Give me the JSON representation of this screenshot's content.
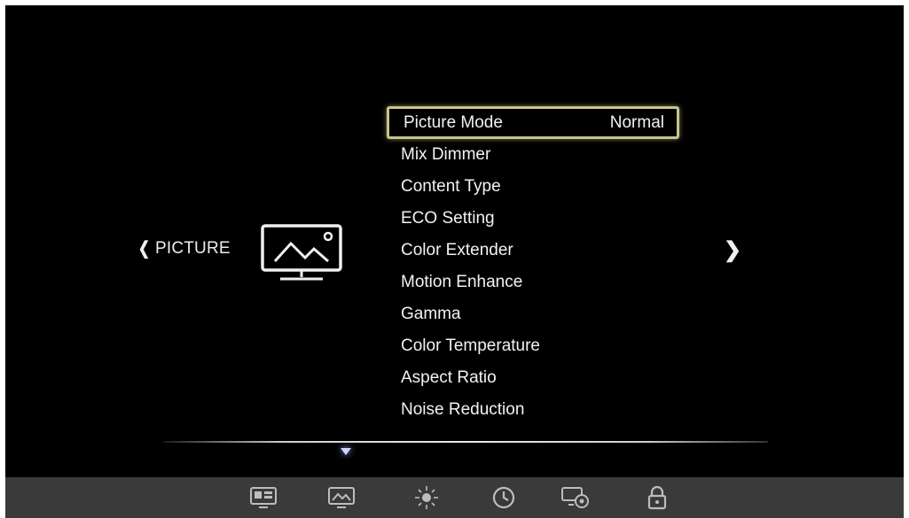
{
  "section": {
    "title": "PICTURE",
    "icon": "picture-icon"
  },
  "menu": {
    "items": [
      {
        "label": "Picture Mode",
        "value": "Normal"
      },
      {
        "label": "Mix Dimmer",
        "value": ""
      },
      {
        "label": "Content Type",
        "value": ""
      },
      {
        "label": "ECO Setting",
        "value": ""
      },
      {
        "label": "Color Extender",
        "value": ""
      },
      {
        "label": "Motion Enhance",
        "value": ""
      },
      {
        "label": "Gamma",
        "value": ""
      },
      {
        "label": "Color Temperature",
        "value": ""
      },
      {
        "label": "Aspect Ratio",
        "value": ""
      },
      {
        "label": "Noise Reduction",
        "value": ""
      }
    ]
  },
  "bottom_bar": {
    "icons": [
      "input-source-icon",
      "picture-settings-icon",
      "sound-icon",
      "timer-clock-icon",
      "setup-gear-icon",
      "lock-icon"
    ]
  },
  "colors": {
    "selection_border": "#c9c58a",
    "background": "#000000",
    "bottom_bar": "#3a3a3a"
  }
}
